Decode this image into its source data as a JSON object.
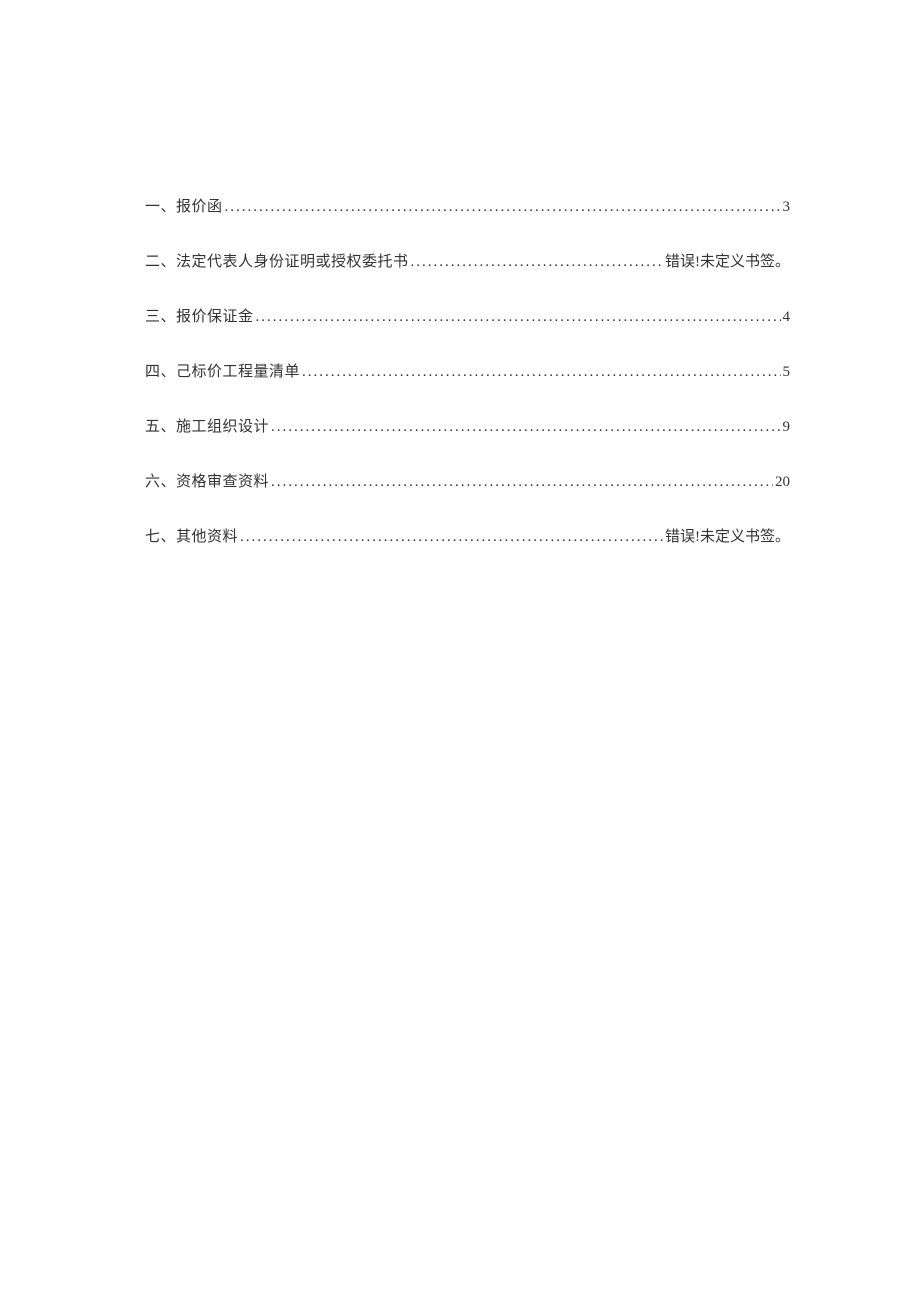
{
  "toc": {
    "entries": [
      {
        "label": "一、报价函",
        "page": "3",
        "error": false
      },
      {
        "label": "二、法定代表人身份证明或授权委托书",
        "page": "错误!未定义书签。",
        "error": true
      },
      {
        "label": "三、报价保证金",
        "page": "4",
        "error": false
      },
      {
        "label": "四、己标价工程量清单",
        "page": "5",
        "error": false
      },
      {
        "label": "五、施工组织设计",
        "page": "9",
        "error": false
      },
      {
        "label": "六、资格审查资料",
        "page": "20",
        "error": false
      },
      {
        "label": "七、其他资料",
        "page": "错误!未定义书签。",
        "error": true
      }
    ]
  }
}
